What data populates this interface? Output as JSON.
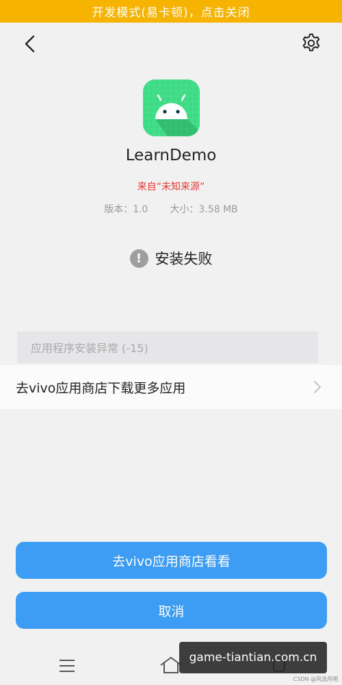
{
  "banner": {
    "text": "开发模式(易卡顿)，点击关闭"
  },
  "header": {
    "back_icon": "chevron-left-icon",
    "settings_icon": "gear-icon"
  },
  "app": {
    "icon": "android-icon",
    "name": "LearnDemo",
    "source": "来自“未知来源”",
    "version_label": "版本：1.0",
    "size_label": "大小：3.58 MB"
  },
  "status": {
    "icon": "exclamation-icon",
    "text": "安装失败"
  },
  "error": {
    "text": "应用程序安装异常 (-15)"
  },
  "store_link": {
    "text": "去vivo应用商店下载更多应用",
    "icon": "chevron-right-icon"
  },
  "buttons": {
    "open_store": "去vivo应用商店看看",
    "cancel": "取消"
  },
  "navbar": {
    "menu_icon": "menu-icon",
    "home_icon": "home-icon",
    "recent_icon": "recent-icon"
  },
  "watermark": {
    "text": "game-tiantian.com.cn"
  },
  "credit": {
    "text": "CSDN @风流月明"
  },
  "colors": {
    "banner": "#f6b400",
    "accent": "#3d9cf3",
    "error_red": "#e53935",
    "android_green": "#3ddc84"
  }
}
